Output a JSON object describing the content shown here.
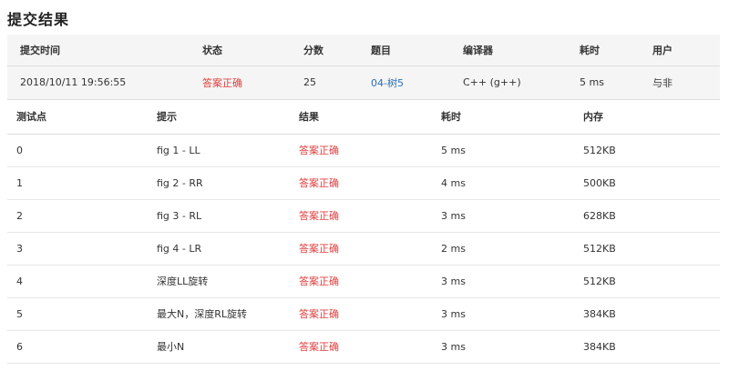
{
  "page": {
    "title": "提交结果"
  },
  "summary": {
    "headers": [
      "提交时间",
      "状态",
      "分数",
      "题目",
      "编译器",
      "耗时",
      "用户"
    ],
    "row": {
      "time": "2018/10/11 19:56:55",
      "status": "答案正确",
      "score": "25",
      "problem": "04-树5",
      "compiler": "C++ (g++)",
      "elapsed": "5 ms",
      "user": "与非"
    }
  },
  "cases": {
    "headers": [
      "测试点",
      "提示",
      "结果",
      "耗时",
      "内存"
    ],
    "rows": [
      {
        "id": "0",
        "hint": "fig 1 - LL",
        "result": "答案正确",
        "time": "5 ms",
        "memory": "512KB"
      },
      {
        "id": "1",
        "hint": "fig 2 - RR",
        "result": "答案正确",
        "time": "4 ms",
        "memory": "500KB"
      },
      {
        "id": "2",
        "hint": "fig 3 - RL",
        "result": "答案正确",
        "time": "3 ms",
        "memory": "628KB"
      },
      {
        "id": "3",
        "hint": "fig 4 - LR",
        "result": "答案正确",
        "time": "2 ms",
        "memory": "512KB"
      },
      {
        "id": "4",
        "hint": "深度LL旋转",
        "result": "答案正确",
        "time": "3 ms",
        "memory": "512KB"
      },
      {
        "id": "5",
        "hint": "最大N，深度RL旋转",
        "result": "答案正确",
        "time": "3 ms",
        "memory": "384KB"
      },
      {
        "id": "6",
        "hint": "最小N",
        "result": "答案正确",
        "time": "3 ms",
        "memory": "384KB"
      }
    ]
  },
  "colors": {
    "accepted": "#e04040",
    "link": "#2a6ebb",
    "header_bg": "#f5f5f5"
  }
}
